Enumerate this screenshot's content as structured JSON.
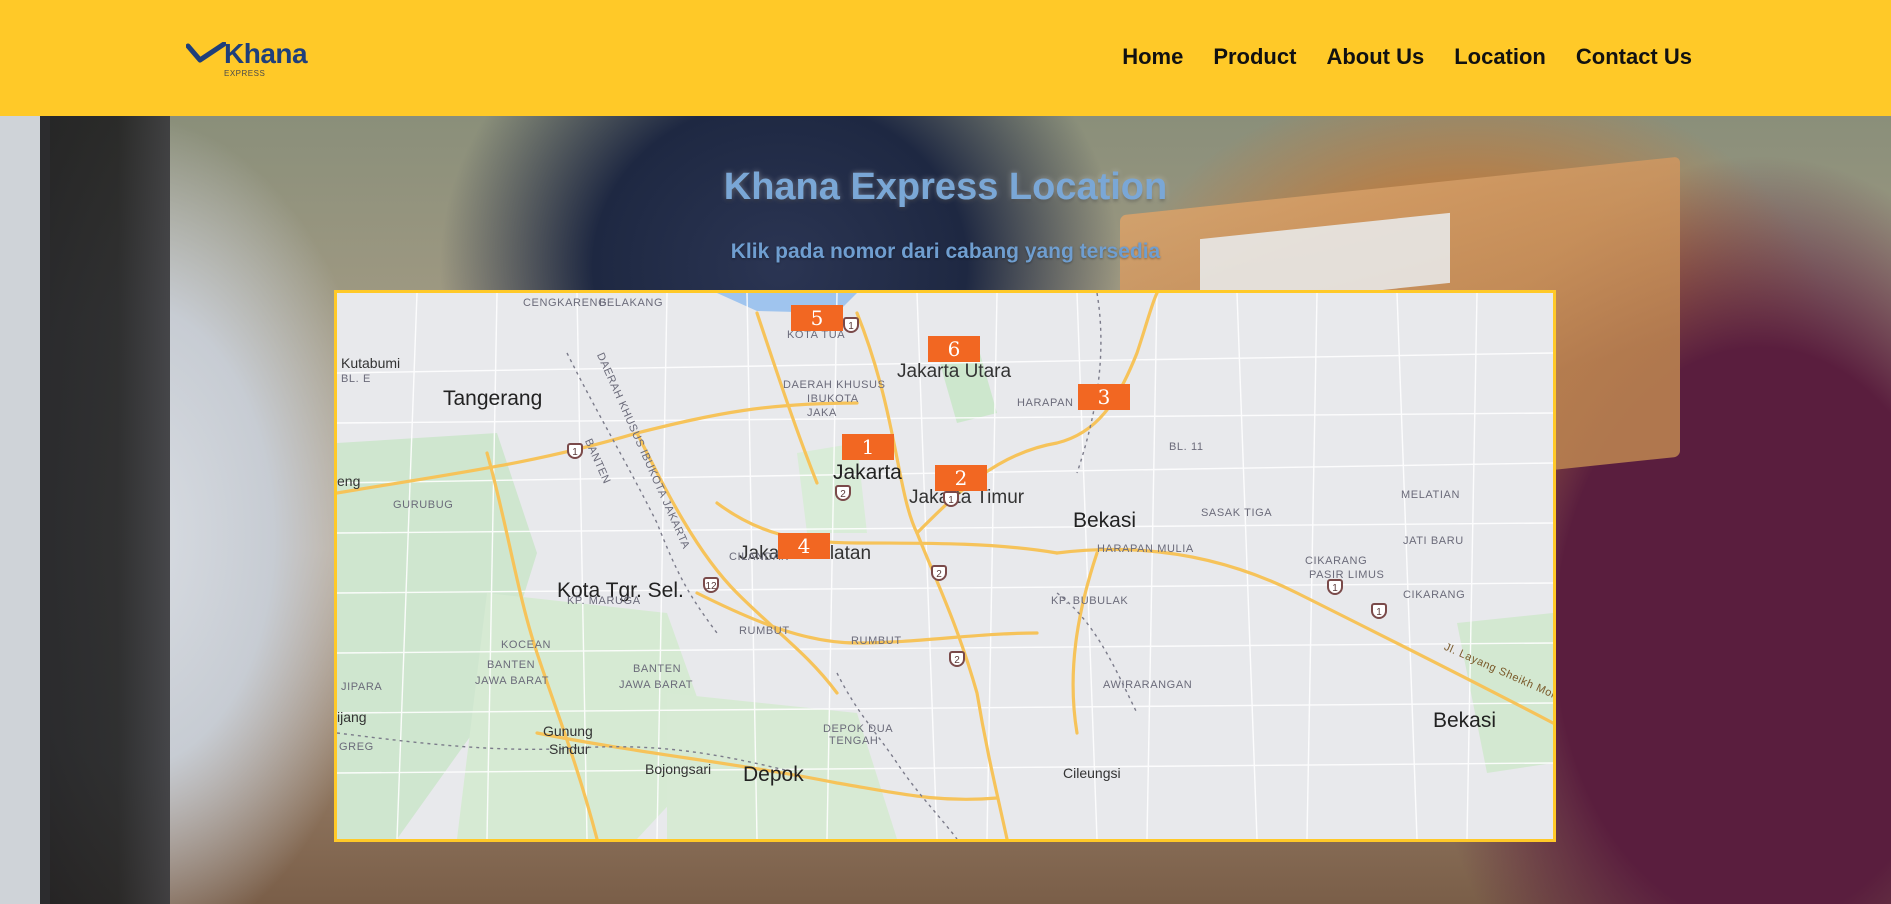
{
  "brand": {
    "name": "Khana",
    "tagline": "EXPRESS"
  },
  "nav": {
    "items": [
      {
        "label": "Home"
      },
      {
        "label": "Product"
      },
      {
        "label": "About Us"
      },
      {
        "label": "Location"
      },
      {
        "label": "Contact Us"
      }
    ]
  },
  "hero": {
    "title": "Khana Express Location",
    "subtitle": "Klik pada nomor dari cabang yang tersedia"
  },
  "map": {
    "markers": [
      {
        "label": "1"
      },
      {
        "label": "2"
      },
      {
        "label": "3"
      },
      {
        "label": "4"
      },
      {
        "label": "5"
      },
      {
        "label": "6"
      }
    ],
    "places": {
      "tangerang": "Tangerang",
      "jakarta": "Jakarta",
      "jakarta_utara": "Jakarta Utara",
      "jakarta_timur": "Jakarta Timur",
      "jakarta_selatan": "Jakarta Selatan",
      "bekasi": "Bekasi",
      "bekasi_2": "Bekasi",
      "kota_tgr_sel": "Kota Tgr. Sel.",
      "depok": "Depok",
      "cileungsi": "Cileungsi",
      "gunung_sindur_1": "Gunung",
      "gunung_sindur_2": "Sindur",
      "bojongsari": "Bojongsari",
      "kutabumi": "Kutabumi",
      "bl_e": "BL. E",
      "eng": "eng",
      "ijang": "ijang",
      "greg": "GREG",
      "jipara": "JIPARA",
      "cengkareng": "CENGKARENG",
      "belakang": "BELAKANG",
      "kota_tua": "KOTA TUA",
      "daerah_khusus_1": "DAERAH KHUSUS",
      "daerah_khusus_2": "IBUKOTA",
      "daerah_khusus_3": "JAKA",
      "harapan_indah": "HARAPAN INDAH",
      "bl_11": "BL. 11",
      "melatian": "MELATIAN",
      "sasak_tiga": "SASAK TIGA",
      "jati_baru": "JATI BARU",
      "harapan_mulia": "HARAPAN MULIA",
      "cikarang": "CIKARANG",
      "pasir_limus": "PASIR LIMUS",
      "cikarang_2": "CIKARANG",
      "kp_bubulak": "KP. BUBULAK",
      "awirarangan": "AWIRARANGAN",
      "gurubug": "GURUBUG",
      "cilandak": "CILANDAK",
      "kp_maruga": "KP. MARUGA",
      "rumbut_1": "RUMBUT",
      "rumbut_2": "RUMBUT",
      "kocean": "KOCEAN",
      "banten_1": "BANTEN",
      "banten_2": "BANTEN",
      "jawa_barat_1": "JAWA BARAT",
      "jawa_barat_2": "JAWA BARAT",
      "depok_dua_1": "DEPOK DUA",
      "depok_dua_2": "TENGAH",
      "road_label": "Jl. Layang Sheikh Moh",
      "border_label_1": "DAERAH KHUSUS IBUKOTA JAKARTA",
      "border_label_2": "BANTEN"
    }
  }
}
